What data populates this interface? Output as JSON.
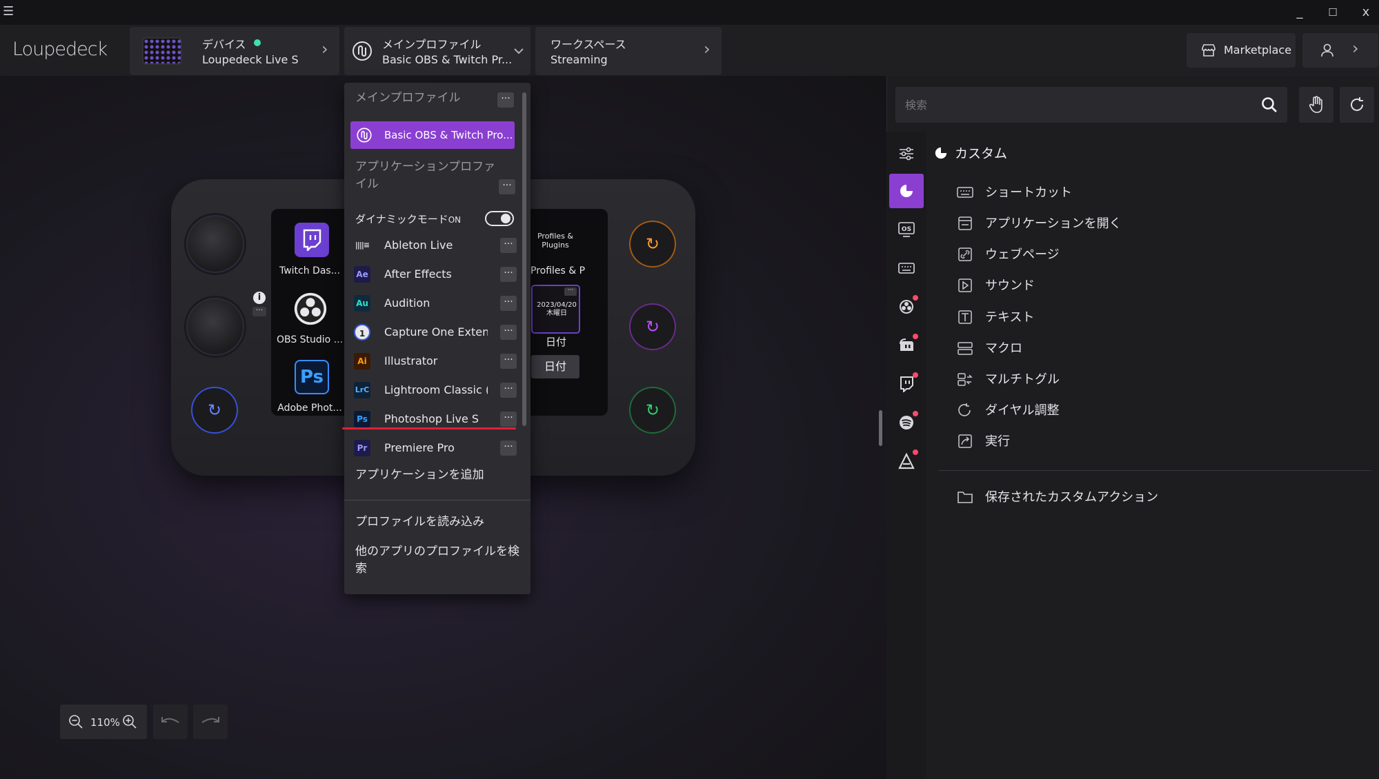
{
  "window": {
    "menu_icon": "☰",
    "controls": [
      "_",
      "☐",
      "x"
    ]
  },
  "header": {
    "logo": "Loupedeck",
    "device": {
      "label": "デバイス",
      "name": "Loupedeck Live S"
    },
    "profile": {
      "label": "メインプロファイル",
      "name": "Basic OBS & Twitch Pr..."
    },
    "workspace": {
      "label": "ワークスペース",
      "name": "Streaming"
    },
    "marketplace_label": "Marketplace"
  },
  "device_tiles": [
    {
      "label": "Twitch Das..."
    },
    {
      "label": "OBS Studio ..."
    },
    {
      "label": "Adobe Phot..."
    },
    {
      "label": "Profiles & Pl...",
      "title": "Profiles & Plugins"
    },
    {
      "label": "日付",
      "date": "2023/04/20",
      "weekday": "木曜日"
    }
  ],
  "tooltip": "日付",
  "dropdown": {
    "main_profile_heading": "メインプロファイル",
    "selected_profile": "Basic OBS & Twitch Pro...",
    "app_profile_heading": "アプリケーションプロファイル",
    "dynamic_mode_label": "ダイナミックモード",
    "dynamic_mode_state": "ON",
    "apps": [
      {
        "name": "Ableton Live",
        "icon": "ableton",
        "abbr": "||||≡"
      },
      {
        "name": "After Effects",
        "icon": "ae",
        "abbr": "Ae"
      },
      {
        "name": "Audition",
        "icon": "au",
        "abbr": "Au"
      },
      {
        "name": "Capture One Extend...",
        "icon": "capture-one",
        "abbr": "1"
      },
      {
        "name": "Illustrator",
        "icon": "ai",
        "abbr": "Ai"
      },
      {
        "name": "Lightroom Classic (L...",
        "icon": "lrc",
        "abbr": "LrC"
      },
      {
        "name": "Photoshop Live S",
        "icon": "ps",
        "abbr": "Ps"
      },
      {
        "name": "Premiere Pro",
        "icon": "pr",
        "abbr": "Pr"
      }
    ],
    "add_app": "アプリケーションを追加",
    "load_profile": "プロファイルを読み込み",
    "search_other": "他のアプリのプロファイルを検索",
    "more_glyph": "···"
  },
  "zoom": {
    "value": "110%"
  },
  "right_panel": {
    "search_placeholder": "検索",
    "category_title": "カスタム",
    "items": [
      {
        "label": "ショートカット",
        "icon": "keyboard-icon"
      },
      {
        "label": "アプリケーションを開く",
        "icon": "window-icon"
      },
      {
        "label": "ウェブページ",
        "icon": "link-icon"
      },
      {
        "label": "サウンド",
        "icon": "play-icon"
      },
      {
        "label": "テキスト",
        "icon": "text-icon"
      },
      {
        "label": "マクロ",
        "icon": "macro-icon"
      },
      {
        "label": "マルチトグル",
        "icon": "multitoggle-icon"
      },
      {
        "label": "ダイヤル調整",
        "icon": "dial-icon"
      },
      {
        "label": "実行",
        "icon": "run-icon"
      }
    ],
    "saved_actions": "保存されたカスタムアクション"
  },
  "colors": {
    "accent": "#8a3fd1",
    "status": "#3de0b0",
    "badge": "#ff4a6a",
    "underline": "#e0203a"
  }
}
